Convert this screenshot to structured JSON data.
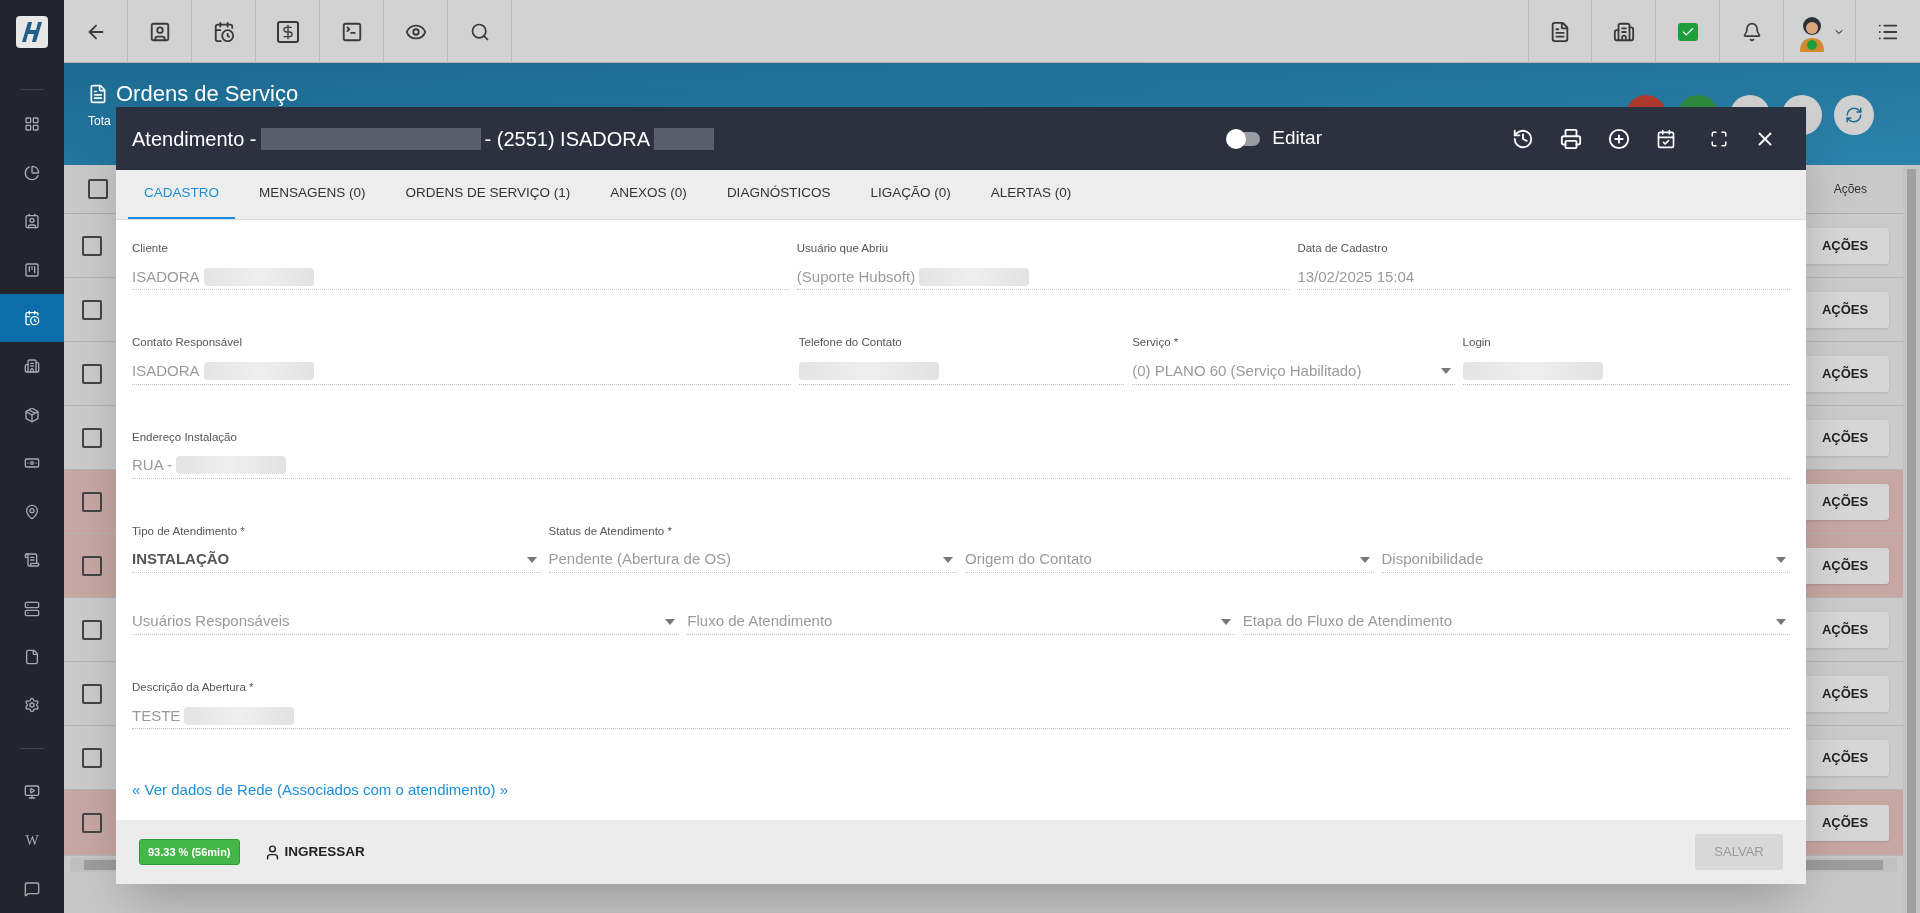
{
  "sidebar": {
    "items": [
      {
        "selected": false
      },
      {
        "selected": false
      },
      {
        "selected": false
      },
      {
        "selected": false
      },
      {
        "selected": true
      },
      {
        "selected": false
      },
      {
        "selected": false
      },
      {
        "selected": false
      },
      {
        "selected": false
      },
      {
        "selected": false
      },
      {
        "selected": false
      },
      {
        "selected": false
      },
      {
        "selected": false
      }
    ],
    "bottom_items": [
      {
        "selected": false
      },
      {
        "label": "W",
        "selected": false
      },
      {
        "selected": false
      }
    ]
  },
  "page": {
    "title": "Ordens de Serviço",
    "subtitle": "Tota",
    "actions_header": "Ações",
    "select_all_checked": false,
    "rows": [
      {
        "highlighted": false,
        "action": "AÇÕES"
      },
      {
        "highlighted": false,
        "action": "AÇÕES"
      },
      {
        "highlighted": false,
        "action": "AÇÕES"
      },
      {
        "highlighted": false,
        "action": "AÇÕES"
      },
      {
        "highlighted": true,
        "action": "AÇÕES"
      },
      {
        "highlighted": true,
        "action": "AÇÕES"
      },
      {
        "highlighted": false,
        "action": "AÇÕES"
      },
      {
        "highlighted": false,
        "action": "AÇÕES"
      },
      {
        "highlighted": false,
        "action": "AÇÕES"
      },
      {
        "highlighted": true,
        "action": "AÇÕES"
      }
    ]
  },
  "modal": {
    "title_prefix": "Atendimento -",
    "title_middle": "- (2551) ISADORA",
    "edit_toggle": {
      "label": "Editar",
      "on": false
    },
    "tabs": [
      {
        "label": "CADASTRO",
        "selected": true
      },
      {
        "label": "MENSAGENS (0)",
        "selected": false
      },
      {
        "label": "ORDENS DE SERVIÇO (1)",
        "selected": false
      },
      {
        "label": "ANEXOS (0)",
        "selected": false
      },
      {
        "label": "DIAGNÓSTICOS",
        "selected": false
      },
      {
        "label": "LIGAÇÃO (0)",
        "selected": false
      },
      {
        "label": "ALERTAS (0)",
        "selected": false
      }
    ],
    "rows": [
      {
        "fields": [
          {
            "kind": "text",
            "label": "Cliente",
            "value": "ISADORA",
            "redacted": true
          },
          {
            "kind": "text",
            "label": "Usuário que Abriu",
            "value": "(Suporte Hubsoft)",
            "redacted": true
          },
          {
            "kind": "text",
            "label": "Data de Cadastro",
            "value": "13/02/2025 15:04",
            "redacted": false
          }
        ]
      },
      {
        "fields": [
          {
            "kind": "text",
            "label": "Contato Responsável",
            "value": "ISADORA",
            "redacted": true
          },
          {
            "kind": "text",
            "label": "Telefone do Contato",
            "redacted": true
          },
          {
            "kind": "select",
            "label": "Serviço *",
            "value": "(0) PLANO 60 (Serviço Habilitado)",
            "redacted": false
          },
          {
            "kind": "text",
            "label": "Login",
            "redacted": true
          }
        ]
      },
      {
        "fields": [
          {
            "kind": "text",
            "label": "Endereço Instalação",
            "value": "RUA -",
            "redacted": true
          }
        ]
      },
      {
        "fields": [
          {
            "kind": "select",
            "label": "Tipo de Atendimento *",
            "value": "INSTALAÇÃO",
            "redacted": false
          },
          {
            "kind": "select",
            "label": "Status de Atendimento *",
            "value": "Pendente (Abertura de OS)",
            "redacted": false
          },
          {
            "kind": "select",
            "placeholder": "Origem do Contato",
            "redacted": false
          },
          {
            "kind": "select",
            "placeholder": "Disponibilidade",
            "redacted": false
          }
        ]
      },
      {
        "fields": [
          {
            "kind": "select",
            "placeholder": "Usuários Responsáveis",
            "redacted": false
          },
          {
            "kind": "select",
            "placeholder": "Fluxo de Atendimento",
            "redacted": false
          },
          {
            "kind": "select",
            "placeholder": "Etapa do Fluxo de Atendimento",
            "redacted": false
          }
        ]
      },
      {
        "fields": [
          {
            "kind": "text",
            "label": "Descrição da Abertura *",
            "value": "TESTE",
            "redacted": true
          }
        ]
      }
    ],
    "network_link": "« Ver dados de Rede (Associados com o atendimento) »",
    "progress_badge": "93.33 % (56min)",
    "join_button": "INGRESSAR",
    "save_button": {
      "label": "SALVAR",
      "disabled": true
    }
  }
}
